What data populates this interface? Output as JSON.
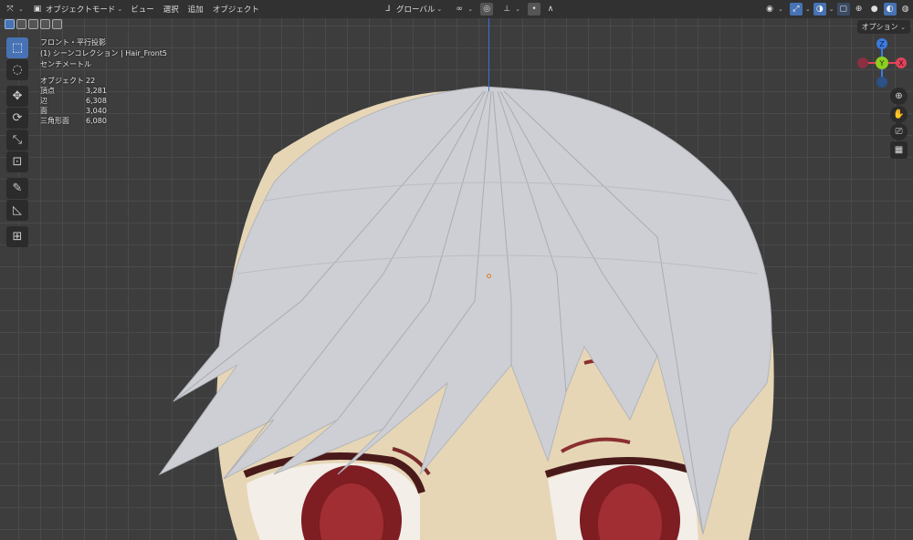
{
  "header": {
    "mode_label": "オブジェクトモード",
    "menus": [
      "ビュー",
      "選択",
      "追加",
      "オブジェクト"
    ],
    "transform_orientation": "グローバル"
  },
  "overlay_info": {
    "view_name": "フロント・平行投影",
    "collection": "(1) シーンコレクション | Hair_Front5",
    "units": "センチメートル",
    "stats": [
      {
        "label": "オブジェクト",
        "value": "22"
      },
      {
        "label": "頂点",
        "value": "3,281"
      },
      {
        "label": "辺",
        "value": "6,308"
      },
      {
        "label": "面",
        "value": "3,040"
      },
      {
        "label": "三角形面",
        "value": "6,080"
      }
    ]
  },
  "options_label": "オプション",
  "gizmo": {
    "x": "X",
    "y": "Y",
    "z": "Z"
  },
  "colors": {
    "accent": "#4772b3",
    "x_axis": "#e0435a",
    "y_axis": "#8ccf1e",
    "z_axis": "#3b7be0"
  }
}
